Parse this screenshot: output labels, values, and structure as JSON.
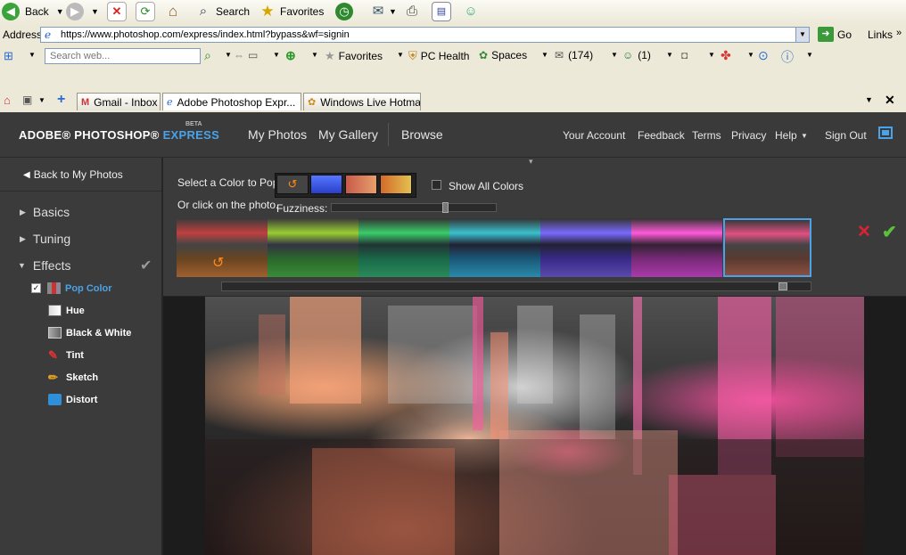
{
  "browser": {
    "toolbar": {
      "back": "Back",
      "search": "Search",
      "favorites": "Favorites"
    },
    "address": {
      "label": "Address",
      "url": "https://www.photoshop.com/express/index.html?bypass&wf=signin",
      "go": "Go",
      "links": "Links"
    },
    "links_bar": {
      "search_placeholder": "Search web...",
      "favorites": "Favorites",
      "pc_health": "PC Health",
      "spaces": "Spaces",
      "mail_count": "(174)",
      "people_count": "(1)"
    },
    "tabs": [
      {
        "label": "Gmail - Inbox"
      },
      {
        "label": "Adobe Photoshop Expr..."
      },
      {
        "label": "Windows Live Hotmail"
      }
    ]
  },
  "app": {
    "logo": {
      "text": "ADOBE® PHOTOSHOP®",
      "accent": "EXPRESS",
      "beta": "BETA"
    },
    "nav": {
      "my_photos": "My Photos",
      "my_gallery": "My Gallery",
      "browse": "Browse"
    },
    "top_links": {
      "your_account": "Your Account",
      "feedback": "Feedback",
      "terms": "Terms",
      "privacy": "Privacy",
      "help": "Help",
      "sign_out": "Sign Out"
    },
    "sidebar": {
      "back": "Back to My Photos",
      "basics": "Basics",
      "tuning": "Tuning",
      "effects": "Effects",
      "pop_color": "Pop Color",
      "items": [
        {
          "label": "Hue"
        },
        {
          "label": "Black & White"
        },
        {
          "label": "Tint"
        },
        {
          "label": "Sketch"
        },
        {
          "label": "Distort"
        }
      ]
    },
    "panel": {
      "select_color": "Select a Color to Pop:",
      "click_photo": "Or click on the photo.",
      "fuzziness": "Fuzziness:",
      "show_all_colors": "Show All Colors",
      "fuzziness_level": 0.7,
      "thumb_scroll": 0.96
    },
    "colors": {
      "accent": "#3f8fd8",
      "header_bg": "#3a3a3a",
      "panel_bg": "#3b3b3b"
    }
  }
}
